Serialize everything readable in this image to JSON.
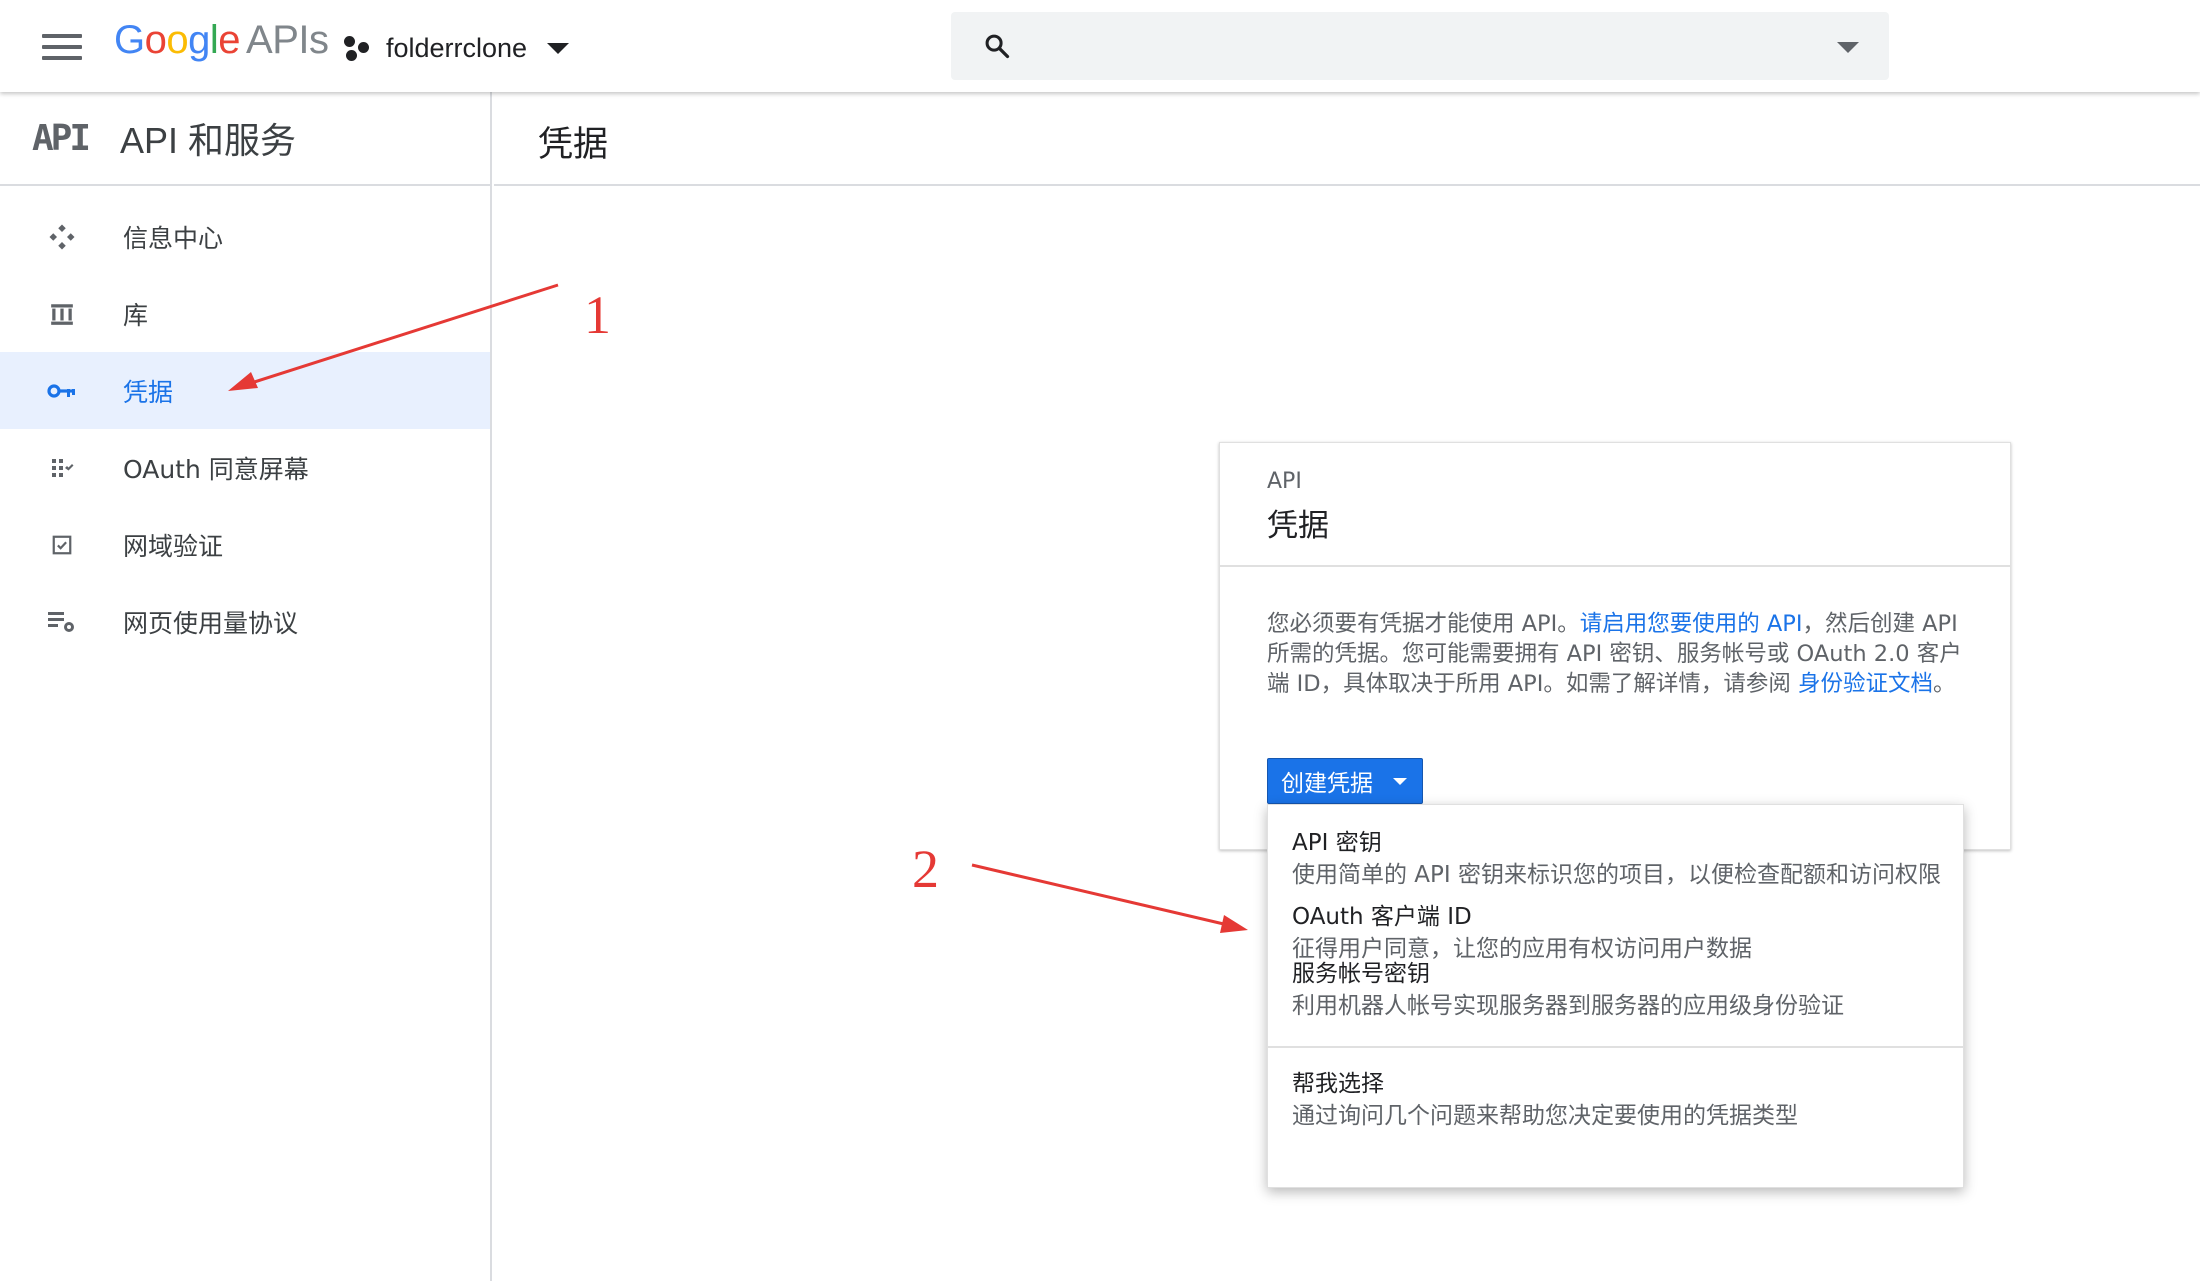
{
  "header": {
    "logo_text": "Google",
    "logo_suffix": "APIs",
    "project_name": "folderrclone",
    "search_placeholder": ""
  },
  "sidebar": {
    "logo": "API",
    "title": "API 和服务",
    "items": [
      {
        "label": "信息中心",
        "icon": "dashboard-icon",
        "active": false
      },
      {
        "label": "库",
        "icon": "library-icon",
        "active": false
      },
      {
        "label": "凭据",
        "icon": "key-icon",
        "active": true
      },
      {
        "label": "OAuth 同意屏幕",
        "icon": "consent-screen-icon",
        "active": false
      },
      {
        "label": "网域验证",
        "icon": "domain-verification-icon",
        "active": false
      },
      {
        "label": "网页使用量协议",
        "icon": "page-usage-agreement-icon",
        "active": false
      }
    ]
  },
  "main": {
    "page_title": "凭据"
  },
  "card": {
    "eyebrow": "API",
    "title": "凭据",
    "text_1": "您必须要有凭据才能使用 API。",
    "link_1": "请启用您要使用的 API",
    "text_2": "，然后创建 API 所需的凭据。您可能需要拥有 API 密钥、服务帐号或 OAuth 2.0 客户端 ID，具体取决于所用 API。如需了解详情，请参阅 ",
    "link_2": "身份验证文档",
    "text_3": "。",
    "create_button": "创建凭据"
  },
  "menu": {
    "items": [
      {
        "title": "API 密钥",
        "desc": "使用简单的 API 密钥来标识您的项目，以便检查配额和访问权限"
      },
      {
        "title": "OAuth 客户端 ID",
        "desc": "征得用户同意，让您的应用有权访问用户数据"
      },
      {
        "title": "服务帐号密钥",
        "desc": "利用机器人帐号实现服务器到服务器的应用级身份验证"
      },
      {
        "title": "帮我选择",
        "desc": "通过询问几个问题来帮助您决定要使用的凭据类型"
      }
    ]
  },
  "annotations": {
    "label_1": "1",
    "label_2": "2",
    "color": "#e53935"
  },
  "colors": {
    "accent": "#1a73e8",
    "active_bg": "#e8f0fe"
  }
}
